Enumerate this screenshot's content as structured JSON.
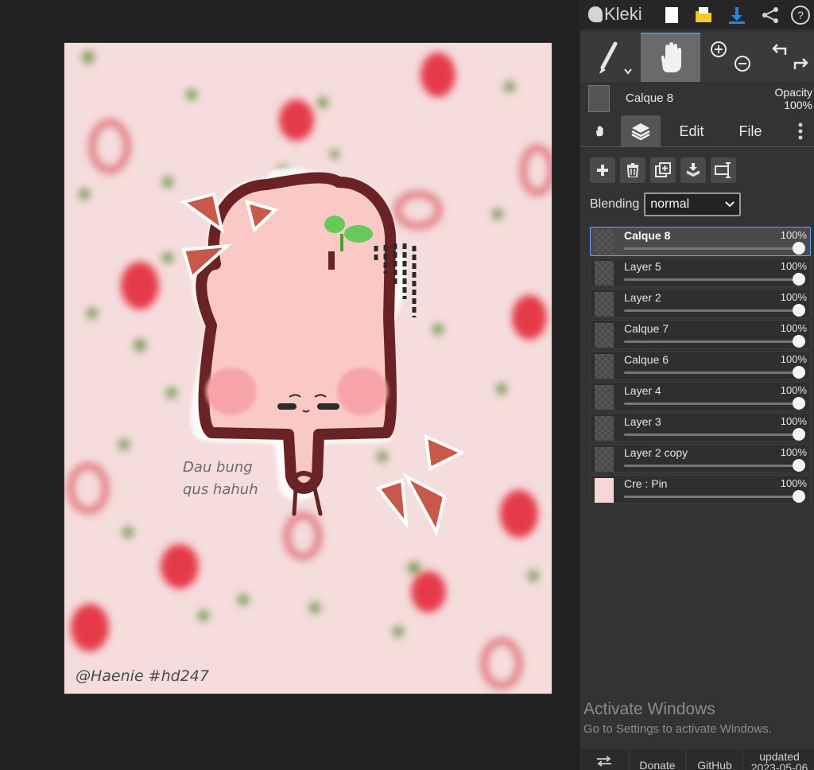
{
  "app": {
    "name": "Kleki"
  },
  "canvas": {
    "captions": [
      "Dau bung",
      "qus hahuh"
    ],
    "watermark": "@Haenie #hd247"
  },
  "layer_summary": {
    "name": "Calque 8",
    "opacity_label": "Opacity",
    "opacity_value": "100%"
  },
  "tabs": {
    "edit": "Edit",
    "file": "File"
  },
  "blending": {
    "label": "Blending",
    "value": "normal"
  },
  "layers": [
    {
      "name": "Calque 8",
      "opacity": "100%",
      "level": 1.0,
      "selected": true
    },
    {
      "name": "Layer 5",
      "opacity": "100%",
      "level": 1.0,
      "selected": false
    },
    {
      "name": "Layer 2",
      "opacity": "100%",
      "level": 1.0,
      "selected": false
    },
    {
      "name": "Calque 7",
      "opacity": "100%",
      "level": 1.0,
      "selected": false
    },
    {
      "name": "Calque 6",
      "opacity": "100%",
      "level": 1.0,
      "selected": false
    },
    {
      "name": "Layer 4",
      "opacity": "100%",
      "level": 1.0,
      "selected": false
    },
    {
      "name": "Layer 3",
      "opacity": "100%",
      "level": 1.0,
      "selected": false
    },
    {
      "name": "Layer 2 copy",
      "opacity": "100%",
      "level": 1.0,
      "selected": false
    },
    {
      "name": "Cre : Pin",
      "opacity": "100%",
      "level": 1.0,
      "selected": false
    }
  ],
  "activation": {
    "title": "Activate Windows",
    "subtitle": "Go to Settings to activate Windows."
  },
  "bottom": {
    "donate": "Donate",
    "github": "GitHub",
    "updated_line1": "updated",
    "updated_line2": "2023-05-06"
  },
  "colors": {
    "accent": "#1e88e5",
    "selection": "#6ea0ff",
    "panel": "#333333",
    "workspace": "#212121"
  },
  "icons": [
    "kleki-logo-icon",
    "new-image-icon",
    "open-folder-icon",
    "download-icon",
    "share-icon",
    "help-icon",
    "brush-icon",
    "hand-icon",
    "zoom-in-icon",
    "zoom-out-icon",
    "undo-icon",
    "redo-icon",
    "layers-icon",
    "more-icon",
    "add-layer-icon",
    "delete-layer-icon",
    "duplicate-layer-icon",
    "merge-down-icon",
    "rename-layer-icon",
    "chevron-down-icon"
  ]
}
